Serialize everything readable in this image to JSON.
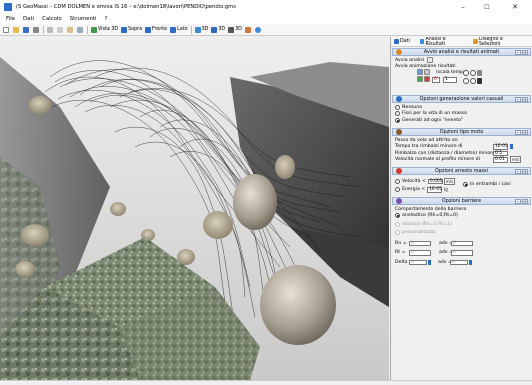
{
  "window": {
    "title": "(S GeoMassi – CDM DOLMEN e omnia IS 16 – e:\\dolmen18\\lavori\\PENDIO\\pendio.gms",
    "minimize": "–",
    "close": "✕"
  },
  "menu": [
    "File",
    "Dati",
    "Calcolo",
    "Strumenti",
    "?"
  ],
  "toolbar": {
    "vista3d": "Vista 3D",
    "sopra": "Sopra",
    "fronte": "Fronte",
    "lato": "Lato",
    "b1": "3D",
    "b2": "3D",
    "b3": "3D"
  },
  "panel": {
    "tabs": [
      "Dati",
      "Analisi e Risultati",
      "Disegno e Selezioni"
    ],
    "sections": {
      "avvio": {
        "title": "Avvio analisi e risultati animati",
        "avvia_label": "Avvia analisi",
        "anim_label": "Avvia animazione risultati",
        "scala_label": "(scala tempo)",
        "scala_value": "1",
        "counter_value": "0"
      },
      "casuali": {
        "title": "Opzioni generazione valori casuali",
        "options": [
          "Nessuno",
          "Fissi per la vita di un masso",
          "Generati ad ogni \"evento\""
        ]
      },
      "moto": {
        "title": "Opzioni tipo moto",
        "intro": "Passa da volo ad attrito se:",
        "rows": [
          {
            "label": "Tempo tra rimbalzi minore di",
            "value": "1E-05"
          },
          {
            "label": "Rimbalzo con (distanza / diametro) minore di",
            "value": "0.5"
          },
          {
            "label": "Velocità normale al profilo minore di",
            "value": "0.01",
            "unit": "m/s"
          }
        ]
      },
      "arresto": {
        "title": "Opzioni arresto massi",
        "velocita_label": "Velocità <",
        "velocita_value": "0.005",
        "velocita_unit": "m/s",
        "energia_label": "Energia <",
        "energia_value": "1E-05",
        "energia_unit": "kJ",
        "both_label": "In entrambi i casi"
      },
      "barriere": {
        "title": "Opzioni barriere",
        "intro": "Comportamento della barriera",
        "options": [
          "anelastico (Rh=0;Rt=0)",
          "elastico (Rh=1;Rt=1)",
          "personalizzato"
        ],
        "params": [
          {
            "l": "Rn =",
            "v": "0",
            "l2": "adv =",
            "v2": "0"
          },
          {
            "l": "Rt =",
            "v": "0",
            "l2": "adv =",
            "v2": "0"
          },
          {
            "l": "Delta =",
            "v": "0",
            "l2": "adv =",
            "v2": "0"
          }
        ]
      }
    }
  },
  "colors": {
    "accent": "#2b6cc4",
    "section_header": "#c9d8ec"
  }
}
